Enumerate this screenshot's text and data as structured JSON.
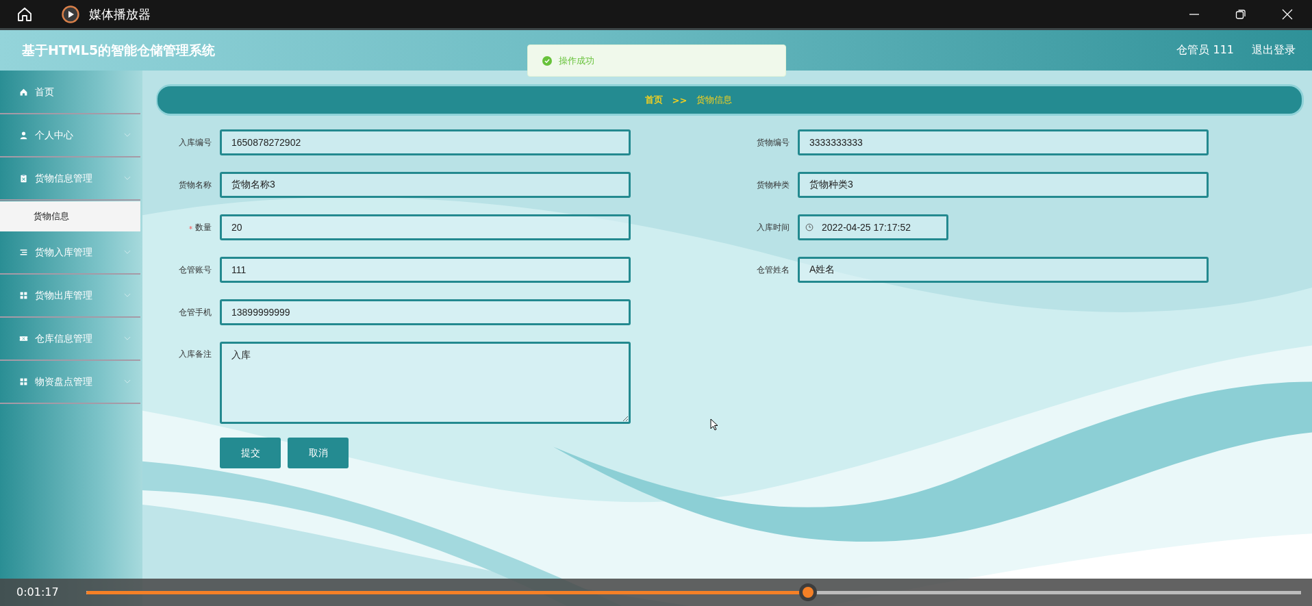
{
  "window": {
    "title": "媒体播放器"
  },
  "app": {
    "title": "基于HTML5的智能仓储管理系统",
    "user": "仓管员 111",
    "logout": "退出登录"
  },
  "toast": {
    "message": "操作成功"
  },
  "sidebar": {
    "items": [
      {
        "label": "首页",
        "kind": "link"
      },
      {
        "label": "个人中心",
        "kind": "menu"
      },
      {
        "label": "货物信息管理",
        "kind": "menu",
        "children": [
          {
            "label": "货物信息",
            "selected": true
          }
        ]
      },
      {
        "label": "货物入库管理",
        "kind": "menu"
      },
      {
        "label": "货物出库管理",
        "kind": "menu"
      },
      {
        "label": "仓库信息管理",
        "kind": "menu"
      },
      {
        "label": "物资盘点管理",
        "kind": "menu"
      }
    ]
  },
  "breadcrumb": {
    "items": [
      "首页",
      "货物信息"
    ],
    "separator": ">>"
  },
  "form": {
    "left_fields": [
      {
        "label": "入库编号",
        "value": "1650878272902",
        "kind": "text",
        "required": false
      },
      {
        "label": "货物名称",
        "value": "货物名称3",
        "kind": "text",
        "required": false
      },
      {
        "label": "数量",
        "value": "20",
        "kind": "text",
        "required": true
      },
      {
        "label": "仓管账号",
        "value": "111",
        "kind": "text",
        "required": false
      },
      {
        "label": "仓管手机",
        "value": "13899999999",
        "kind": "text",
        "required": false
      },
      {
        "label": "入库备注",
        "value": "入库",
        "kind": "textarea",
        "required": false
      }
    ],
    "right_fields": [
      {
        "label": "货物编号",
        "value": "3333333333",
        "kind": "text",
        "required": false
      },
      {
        "label": "货物种类",
        "value": "货物种类3",
        "kind": "text",
        "required": false
      },
      {
        "label": "入库时间",
        "value": "2022-04-25 17:17:52",
        "kind": "datetime",
        "required": false
      },
      {
        "label": "仓管姓名",
        "value": "A姓名",
        "kind": "text",
        "required": false
      }
    ],
    "buttons": [
      "提交",
      "取消"
    ]
  },
  "player": {
    "time": "0:01:17",
    "level": 0.594
  }
}
